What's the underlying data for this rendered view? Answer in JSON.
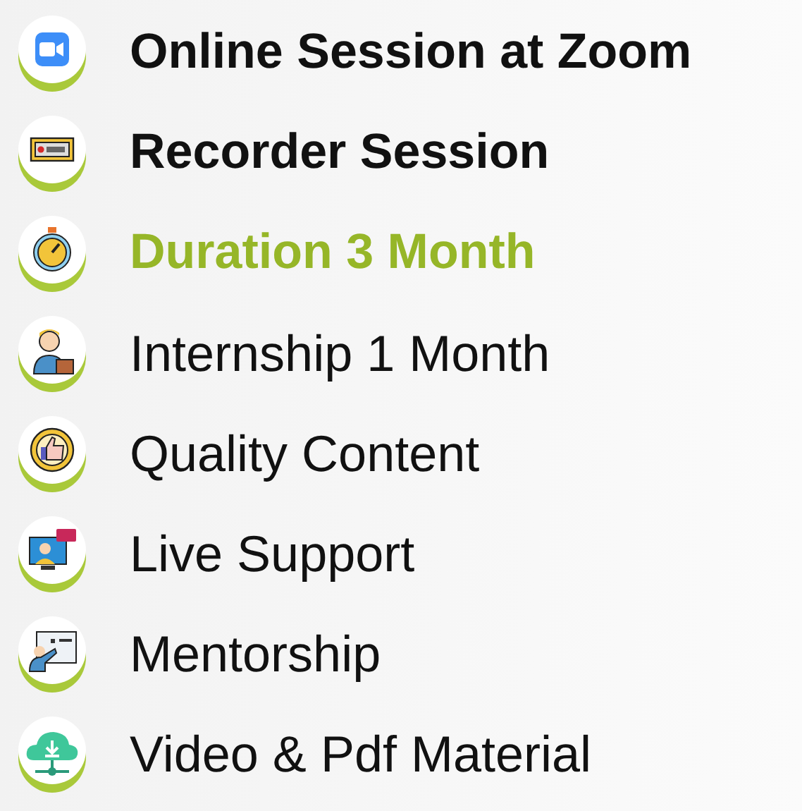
{
  "features": [
    {
      "label": "Online Session at Zoom",
      "kind": "bold"
    },
    {
      "label": "Recorder Session",
      "kind": "bold"
    },
    {
      "label": "Duration 3 Month",
      "kind": "accent"
    },
    {
      "label": "Internship 1 Month",
      "kind": "normal"
    },
    {
      "label": "Quality Content",
      "kind": "normal"
    },
    {
      "label": "Live Support",
      "kind": "normal"
    },
    {
      "label": "Mentorship",
      "kind": "normal"
    },
    {
      "label": "Video & Pdf Material",
      "kind": "normal"
    }
  ]
}
